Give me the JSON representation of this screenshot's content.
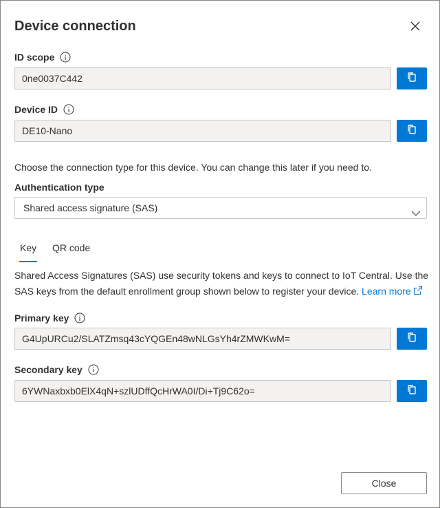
{
  "dialog": {
    "title": "Device connection",
    "close_icon": "close-icon"
  },
  "id_scope": {
    "label": "ID scope",
    "value": "0ne0037C442"
  },
  "device_id": {
    "label": "Device ID",
    "value": "DE10-Nano"
  },
  "connection_hint": "Choose the connection type for this device. You can change this later if you need to.",
  "auth": {
    "label": "Authentication type",
    "selected": "Shared access signature (SAS)"
  },
  "tabs": [
    {
      "label": "Key",
      "active": true
    },
    {
      "label": "QR code",
      "active": false
    }
  ],
  "sas_description": {
    "line1": "Shared Access Signatures (SAS) use security tokens and keys to connect to IoT Central. Use the",
    "line2": "SAS keys from the default enrollment group shown below to register your device.",
    "link": "Learn more"
  },
  "primary_key": {
    "label": "Primary key",
    "value": "G4UpURCu2/SLATZmsq43cYQGEn48wNLGsYh4rZMWKwM="
  },
  "secondary_key": {
    "label": "Secondary key",
    "value": "6YWNaxbxb0ElX4qN+szlUDffQcHrWA0I/Di+Tj9C62o="
  },
  "footer": {
    "close_label": "Close"
  },
  "colors": {
    "accent": "#0078d4",
    "field_bg": "#f3f2f1",
    "text": "#323130"
  }
}
